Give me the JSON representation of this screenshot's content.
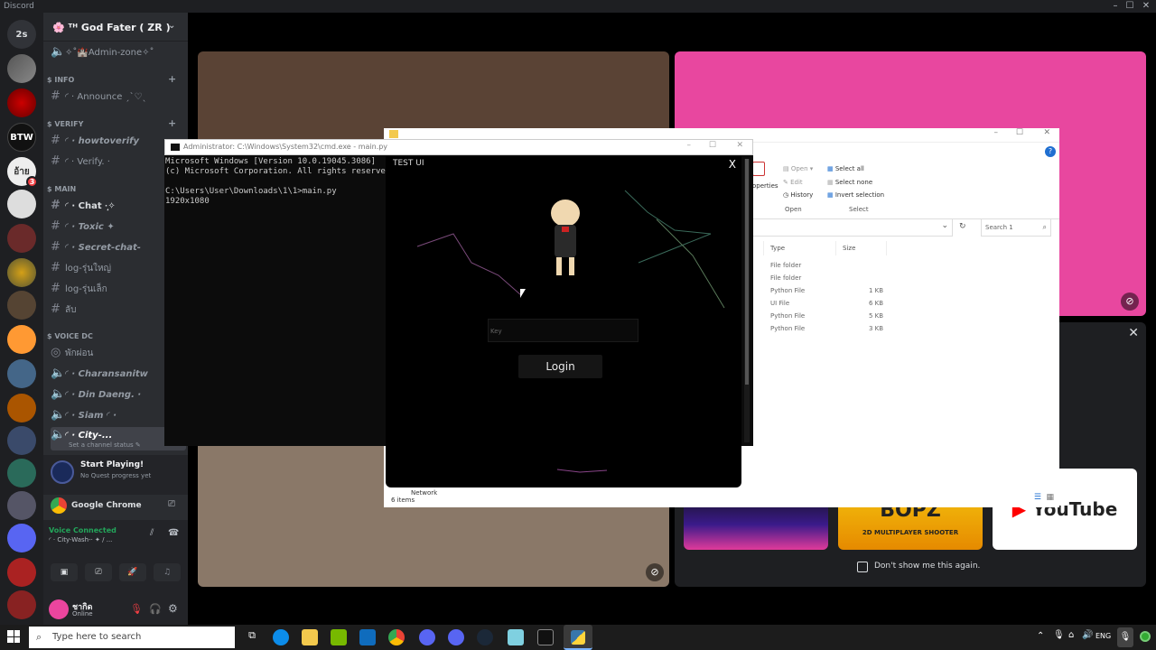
{
  "app": {
    "title": "Discord"
  },
  "servers": [
    {
      "label": "2s"
    },
    {
      "label": ""
    },
    {
      "label": ""
    },
    {
      "label": "BTW"
    },
    {
      "label": "",
      "badge": "3"
    }
  ],
  "guild": {
    "name": "🌸 ᵀᴴ God Fater ( ZR )"
  },
  "channels": {
    "admin": "✧˚🏰Admin-zone✧˚",
    "cat_info": "$ INFO",
    "announce": "◜ · Announce ˏˋ♡ˎ",
    "cat_verify": "$ VERIFY",
    "howtoverify": "◜ · howtoverify",
    "verify": "◜ · Verify. ·",
    "cat_main": "$ MAIN",
    "chat": "◜ · Chat ·̩͙✧",
    "toxic": "◜ · Toxic ✦",
    "secret": "◜ · Secret-chat-",
    "log1": "log-รุ่นใหญ่",
    "log2": "log-รุ่นเล็ก",
    "lab": "ลับ",
    "cat_voice": "$ VOICE DC",
    "phak": "พักผ่อน",
    "v1": "◜ · Charansanitw",
    "v2": "◜ · Din Daeng. ·",
    "v3": "◜ · Siam ◜ ·",
    "v4": "◜ · City-...",
    "status_hint": "Set a channel status ✎"
  },
  "quest": {
    "title": "Start Playing!",
    "subtitle": "No Quest progress yet"
  },
  "activity": {
    "app": "Google Chrome"
  },
  "voice": {
    "status": "Voice Connected",
    "channel": "◜ · City-Wash-· ✦ / ..."
  },
  "user": {
    "name": "ชากิด",
    "status": "Online"
  },
  "cmd": {
    "title": "Administrator: C:\\Windows\\System32\\cmd.exe - main.py",
    "lines": "Microsoft Windows [Version 10.0.19045.3086]\n(c) Microsoft Corporation. All rights reserved.\n\nC:\\Users\\User\\Downloads\\1\\1>main.py\n1920x1080"
  },
  "explorer": {
    "ribbon": {
      "open": "Open ▾",
      "edit": "Edit",
      "history": "History",
      "group_open": "Open",
      "select_all": "Select all",
      "select_none": "Select none",
      "invert": "Invert selection",
      "group_select": "Select",
      "properties": "operties"
    },
    "search_placeholder": "Search 1",
    "col_type": "Type",
    "col_size": "Size",
    "rows": [
      {
        "type": "File folder",
        "size": ""
      },
      {
        "type": "File folder",
        "size": ""
      },
      {
        "type": "Python File",
        "size": "1 KB"
      },
      {
        "type": "UI File",
        "size": "6 KB"
      },
      {
        "type": "Python File",
        "size": "5 KB"
      },
      {
        "type": "Python File",
        "size": "3 KB"
      }
    ],
    "network": "Network",
    "count": "6 items"
  },
  "testui": {
    "title": "TEST UI",
    "close": "X",
    "key_placeholder": "Key",
    "login": "Login"
  },
  "popup": {
    "dont_show": "Don't show me this again.",
    "youtube": "YouTube",
    "bopz": "BOPZ",
    "bopz_sub": "2D MULTIPLAYER SHOOTER"
  },
  "taskbar": {
    "search": "Type here to search",
    "lang": "ENG"
  },
  "colors": {
    "pink": "#e8479f",
    "brown": "#5a4335",
    "beige": "#8a7868",
    "discord_bg": "#2b2d31"
  }
}
